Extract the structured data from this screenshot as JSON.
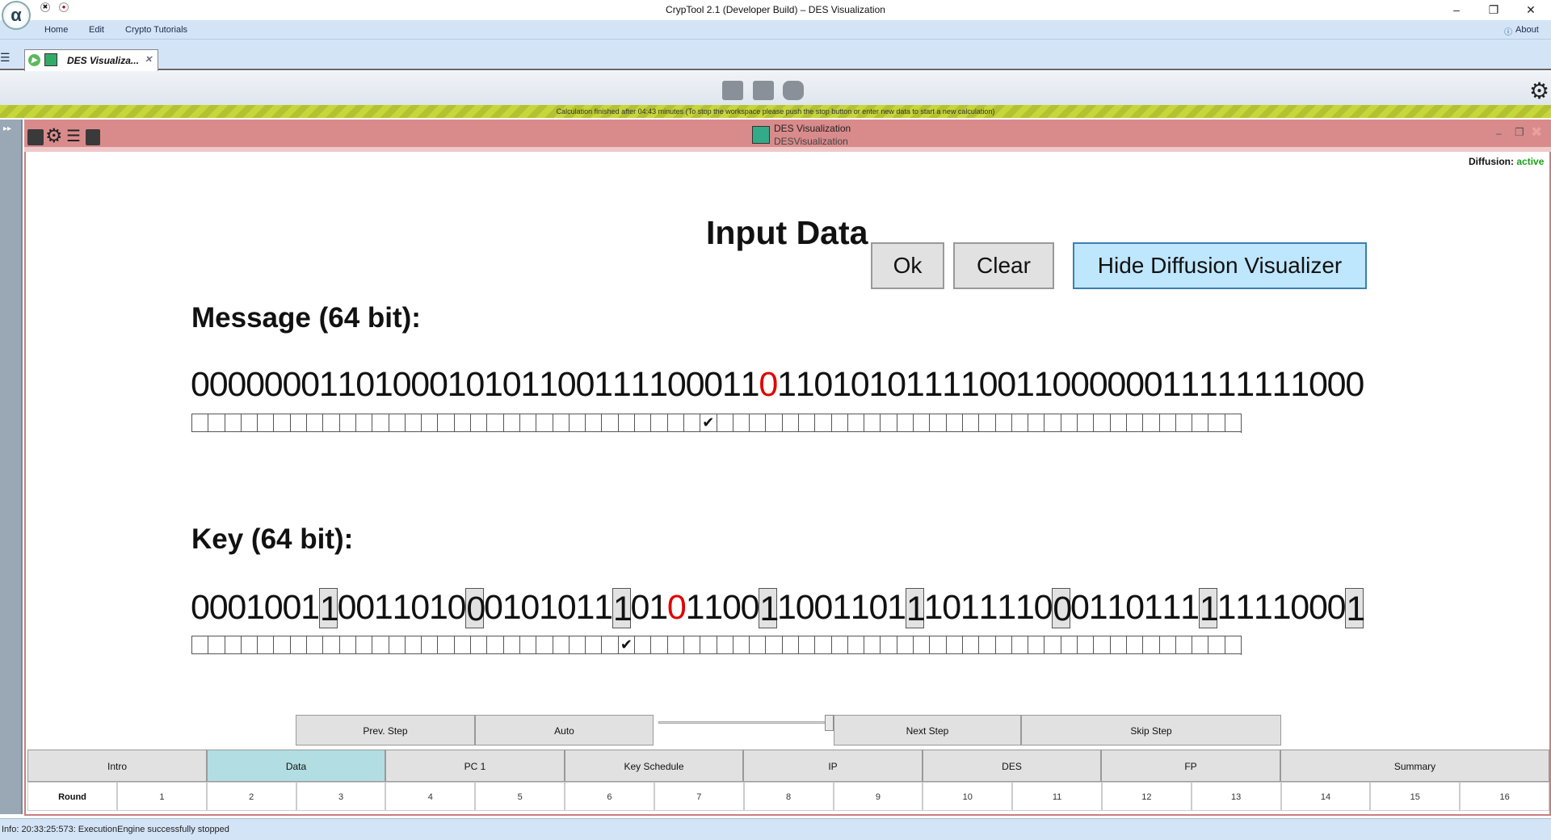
{
  "window": {
    "title": "CrypTool 2.1 (Developer Build) – DES Visualization",
    "min": "–",
    "restore": "❐",
    "close": "✕"
  },
  "menu": {
    "home": "Home",
    "edit": "Edit",
    "tutorials": "Crypto Tutorials",
    "about": "About"
  },
  "tab": {
    "label": "DES Visualiza...",
    "close": "✕"
  },
  "stripe_text": "Calculation finished after 04:43 minutes (To stop the workspace please push the stop button or enter new data to start a new calculation)",
  "plugin": {
    "title": "DES Visualization",
    "subtitle": "DESVisualization",
    "diffusion_label": "Diffusion:",
    "diffusion_state": "active"
  },
  "content": {
    "heading": "Input Data",
    "ok": "Ok",
    "clear": "Clear",
    "hide_diffusion": "Hide Diffusion Visualizer",
    "message_label": "Message  (64 bit):",
    "key_label": "Key  (64 bit):",
    "message_bits": "0000000110100010101100111100011011010101111001100000011111111000",
    "message_flipped_index": 31,
    "key_bits": "0001001100110100010101110101100110011011101111000110111111110001",
    "key_flipped_index": 26,
    "key_parity_indices": [
      7,
      15,
      23,
      31,
      39,
      47,
      55,
      63
    ],
    "checkmark": "✔"
  },
  "controls": {
    "prev": "Prev. Step",
    "auto": "Auto",
    "next": "Next Step",
    "skip": "Skip Step",
    "speed_position": 0.98
  },
  "steps": [
    "Intro",
    "Data",
    "PC 1",
    "Key Schedule",
    "IP",
    "DES",
    "FP",
    "Summary"
  ],
  "active_step": "Data",
  "rounds": {
    "label": "Round",
    "numbers": [
      "1",
      "2",
      "3",
      "4",
      "5",
      "6",
      "7",
      "8",
      "9",
      "10",
      "11",
      "12",
      "13",
      "14",
      "15",
      "16"
    ]
  },
  "status": "Info: 20:33:25:573: ExecutionEngine successfully stopped",
  "colors": {
    "accent_red": "#e00000",
    "active_green": "#1aa01a",
    "active_step": "#b2dde2",
    "plugin_header": "#d98b8b"
  }
}
